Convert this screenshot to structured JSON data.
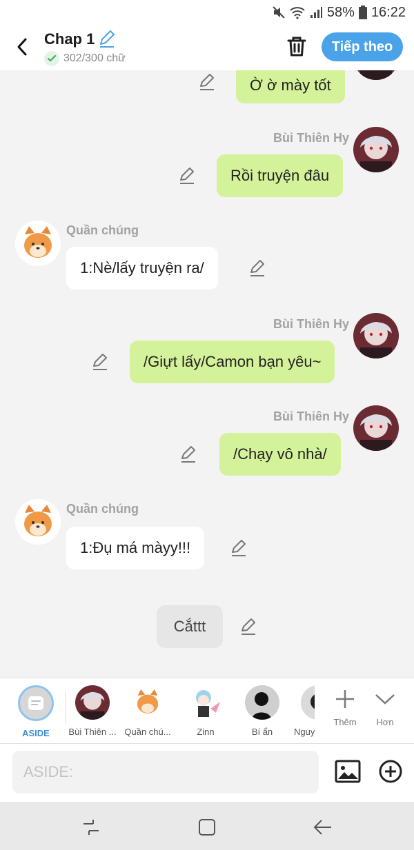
{
  "status_bar": {
    "battery": "58%",
    "time": "16:22"
  },
  "header": {
    "title": "Chap 1",
    "word_count": "302/300 chữ",
    "next_label": "Tiếp theo"
  },
  "messages": [
    {
      "side": "right",
      "name": "",
      "text": "Ờ ờ mày tốt"
    },
    {
      "side": "right",
      "name": "Bùi Thiên Hy",
      "text": "Rồi truyện đâu"
    },
    {
      "side": "left",
      "name": "Quần chúng",
      "text": "1:Nè/lấy truyện ra/"
    },
    {
      "side": "right",
      "name": "Bùi Thiên Hy",
      "text": "/Giựt lấy/Camon bạn yêu~"
    },
    {
      "side": "right",
      "name": "Bùi Thiên Hy",
      "text": "/Chạy vô nhà/"
    },
    {
      "side": "left",
      "name": "Quần chúng",
      "text": "1:Đụ má màyy!!!"
    },
    {
      "side": "aside",
      "name": "",
      "text": "Cắttt"
    }
  ],
  "characters": [
    {
      "label": "ASIDE"
    },
    {
      "label": "Bùi Thiên ..."
    },
    {
      "label": "Quần chú..."
    },
    {
      "label": "Zinn"
    },
    {
      "label": "Bí ẩn"
    },
    {
      "label": "Nguy"
    }
  ],
  "tools": {
    "more_label": "Thêm",
    "expand_label": "Hơn"
  },
  "input": {
    "placeholder": "ASIDE:"
  },
  "colors": {
    "accent": "#4aa3e8",
    "right_bubble": "#d4f29a",
    "left_bubble": "#ffffff"
  }
}
